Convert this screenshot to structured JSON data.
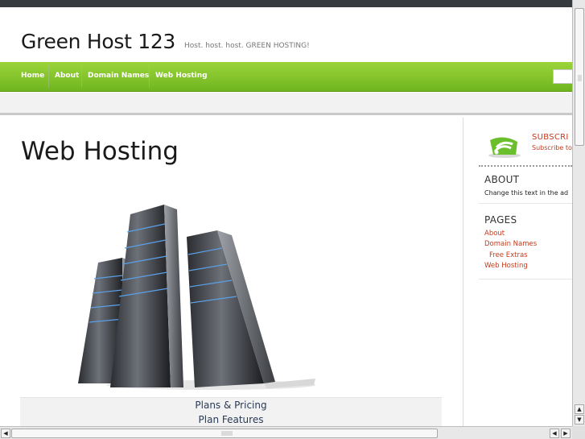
{
  "header": {
    "site_title": "Green Host 123",
    "tagline": "Host. host. host. GREEN HOSTING!"
  },
  "nav": {
    "items": [
      {
        "label": "Home"
      },
      {
        "label": "About"
      },
      {
        "label": "Domain Names"
      },
      {
        "label": "Web Hosting"
      }
    ],
    "accent": "#7cc12a"
  },
  "main": {
    "title": "Web Hosting",
    "image": "server-rack-image",
    "links": [
      {
        "label": "Plans & Pricing"
      },
      {
        "label": "Plan Features"
      }
    ]
  },
  "sidebar": {
    "subscribe": {
      "title": "SUBSCRI",
      "text": "Subscribe to",
      "icon": "rss-icon"
    },
    "about": {
      "title": "ABOUT",
      "text": "Change this text in the ad"
    },
    "pages": {
      "title": "PAGES",
      "items": [
        {
          "label": "About"
        },
        {
          "label": "Domain Names"
        },
        {
          "label": "Free Extras"
        },
        {
          "label": "Web Hosting"
        }
      ]
    },
    "link_color": "#c33b1e"
  },
  "scrollbars": {
    "up": "▲",
    "down": "▼",
    "left": "◀",
    "right": "▶"
  }
}
